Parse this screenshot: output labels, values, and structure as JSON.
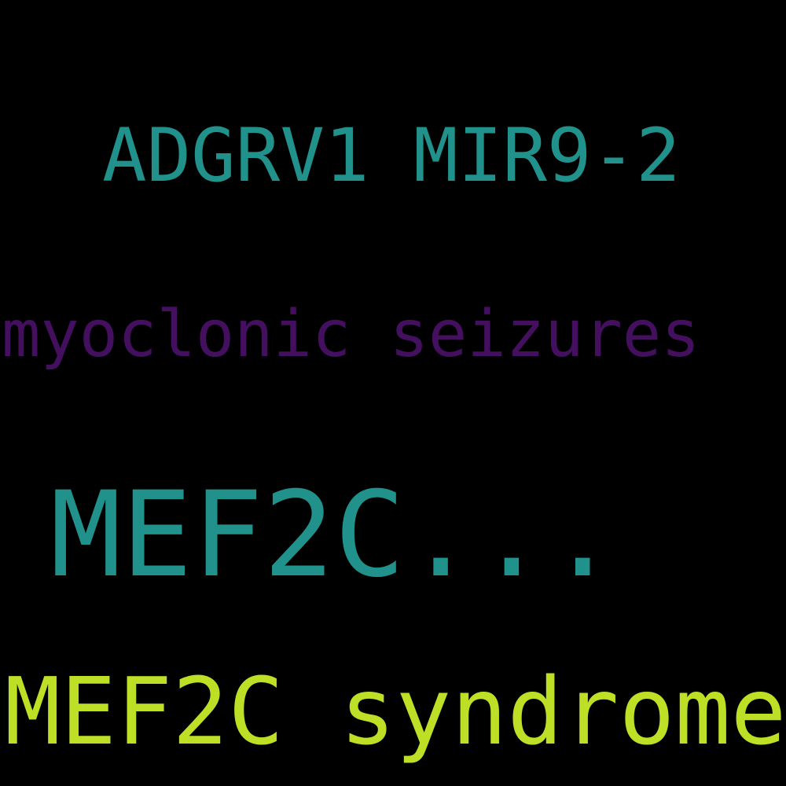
{
  "colors": {
    "background": "#000000",
    "teal": "#21918c",
    "purple": "#440f5f",
    "lime": "#bddf26"
  },
  "words": [
    {
      "id": "adgrv1",
      "text": "ADGRV1 MIR9-2",
      "color": "#21918c"
    },
    {
      "id": "myoclonic",
      "text": "myoclonic seizures",
      "color": "#440f5f"
    },
    {
      "id": "mef2c-dots",
      "text": "MEF2C...",
      "color": "#21918c"
    },
    {
      "id": "mef2c-syndrome",
      "text": "MEF2C syndrome",
      "color": "#bddf26"
    }
  ]
}
